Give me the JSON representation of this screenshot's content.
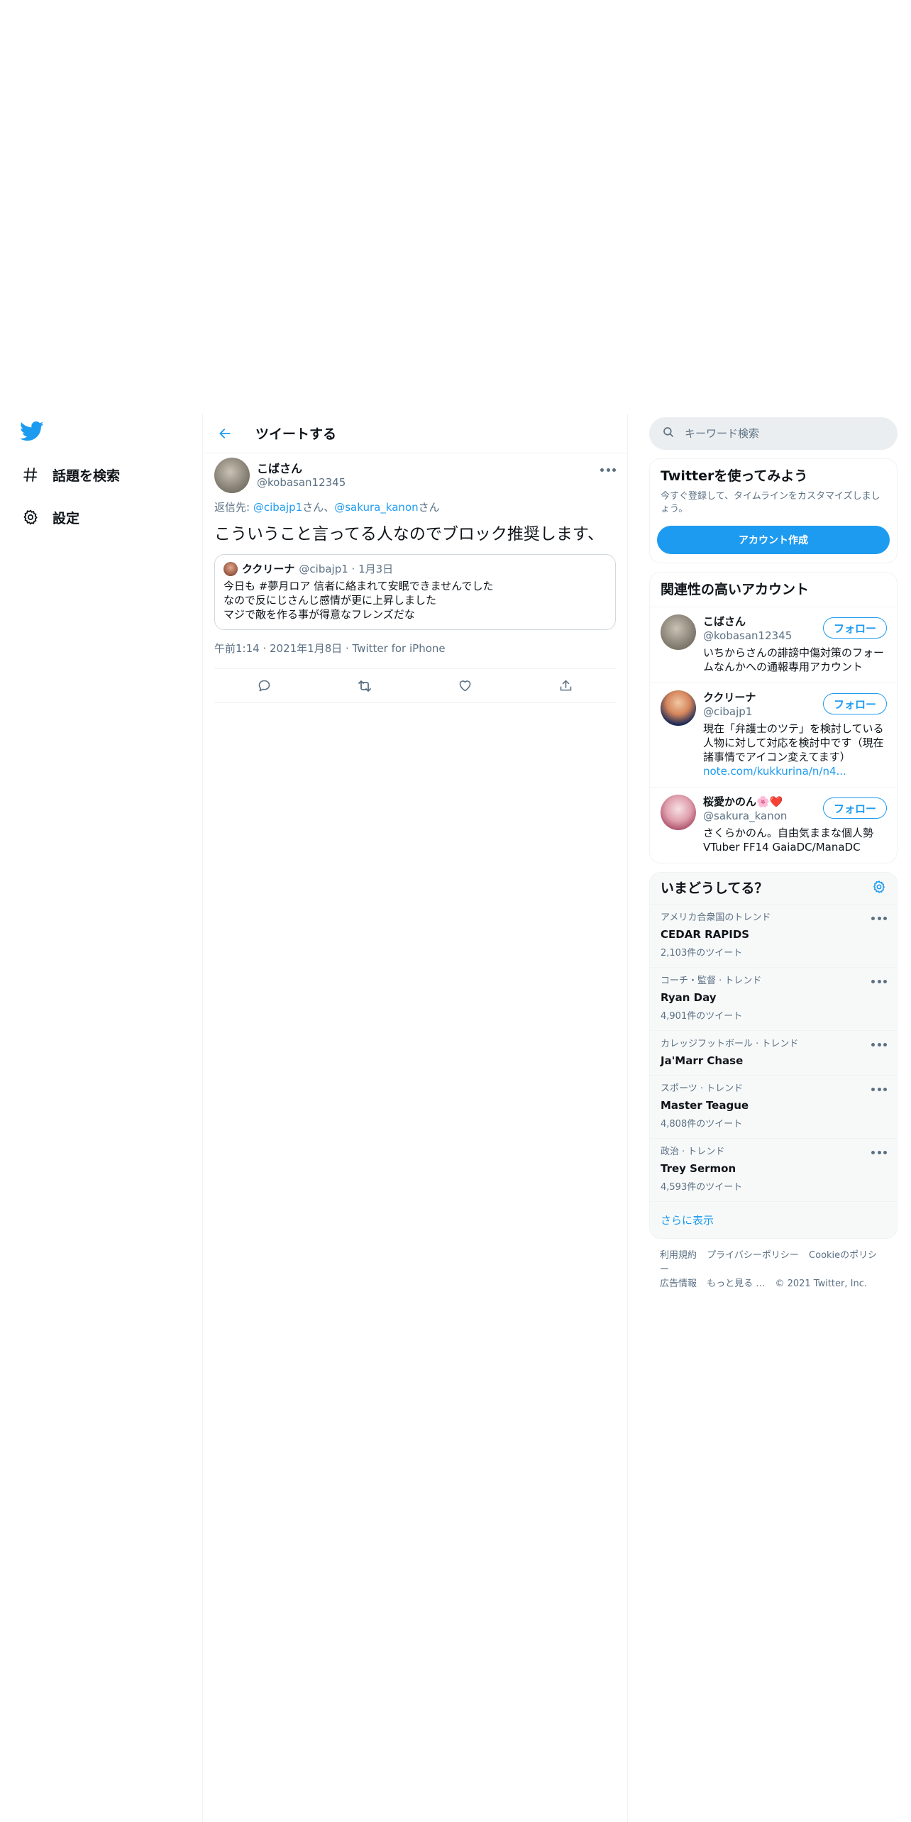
{
  "nav": {
    "items": [
      {
        "label": "話題を検索",
        "icon": "hashtag-icon"
      },
      {
        "label": "設定",
        "icon": "gear-icon"
      }
    ]
  },
  "header": {
    "title": "ツイートする"
  },
  "tweet": {
    "name": "こばさん",
    "handle": "@kobasan12345",
    "replying_prefix": "返信先: ",
    "reply_to_1": "@cibajp1",
    "reply_sep": "さん、",
    "reply_to_2": "@sakura_kanon",
    "reply_suffix": "さん",
    "text": "こういうこと言ってる人なのでブロック推奨します、",
    "quote": {
      "name": "ククリーナ",
      "handle_date": "@cibajp1 · 1月3日",
      "line1": "今日も #夢月ロア 信者に絡まれて安眠できませんでした",
      "line2": "なので反にじさんじ感情が更に上昇しました",
      "line3": "マジで敵を作る事が得意なフレンズだな"
    },
    "meta": "午前1:14 · 2021年1月8日 · Twitter for iPhone"
  },
  "search": {
    "placeholder": "キーワード検索"
  },
  "signup": {
    "title": "Twitterを使ってみよう",
    "desc": "今すぐ登録して、タイムラインをカスタマイズしましょう。",
    "button": "アカウント作成"
  },
  "related": {
    "title": "関連性の高いアカウント",
    "follow_label": "フォロー",
    "accounts": [
      {
        "name": "こばさん",
        "handle": "@kobasan12345",
        "bio": "いちからさんの誹謗中傷対策のフォームなんかへの通報専用アカウント",
        "link": ""
      },
      {
        "name": "ククリーナ",
        "handle": "@cibajp1",
        "bio": "現在「弁護士のツテ」を検討している人物に対して対応を検討中です（現在諸事情でアイコン変えてます）",
        "link": "note.com/kukkurina/n/n4..."
      },
      {
        "name": "桜愛かのん🌸❤️",
        "handle": "@sakura_kanon",
        "bio": "さくらかのん。自由気ままな個人勢VTuber FF14 GaiaDC/ManaDC",
        "link": ""
      }
    ]
  },
  "trends": {
    "title": "いまどうしてる？",
    "items": [
      {
        "context": "アメリカ合衆国のトレンド",
        "title": "CEDAR RAPIDS",
        "count": "2,103件のツイート"
      },
      {
        "context": "コーチ・監督 · トレンド",
        "title": "Ryan Day",
        "count": "4,901件のツイート"
      },
      {
        "context": "カレッジフットボール · トレンド",
        "title": "Ja'Marr Chase",
        "count": ""
      },
      {
        "context": "スポーツ · トレンド",
        "title": "Master Teague",
        "count": "4,808件のツイート"
      },
      {
        "context": "政治 · トレンド",
        "title": "Trey Sermon",
        "count": "4,593件のツイート"
      }
    ],
    "show_more": "さらに表示"
  },
  "footer": {
    "terms": "利用規約",
    "privacy": "プライバシーポリシー",
    "cookie": "Cookieのポリシー",
    "ads": "広告情報",
    "more": "もっと見る …",
    "copyright": "© 2021 Twitter, Inc."
  },
  "colors": {
    "accent": "#1d9bf0",
    "secondary_text": "#5b7083",
    "border": "#eff3f4"
  }
}
